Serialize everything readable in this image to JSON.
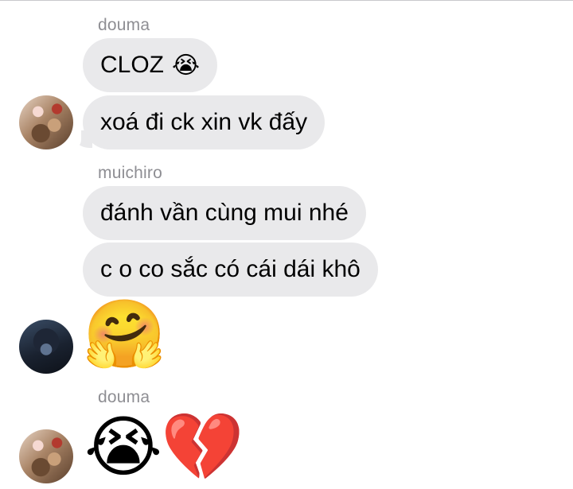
{
  "messages": [
    {
      "sender": "douma",
      "bubbles": [
        "CLOZ",
        "xoá đi ck xin vk đấy"
      ],
      "emoji_after_first": "😭",
      "avatar": "douma-avatar"
    },
    {
      "sender": "muichiro",
      "bubbles": [
        "đánh vần cùng mui nhé",
        "c o co sắc có cái dái khô"
      ],
      "reaction_emoji": "🤗",
      "avatar": "muichiro-avatar"
    },
    {
      "sender": "douma",
      "emojis": [
        "😭",
        "💔"
      ],
      "avatar": "douma-avatar"
    }
  ],
  "colors": {
    "bubble_bg": "#e9e9eb",
    "sender_text": "#8e8e93",
    "background": "#ffffff"
  }
}
